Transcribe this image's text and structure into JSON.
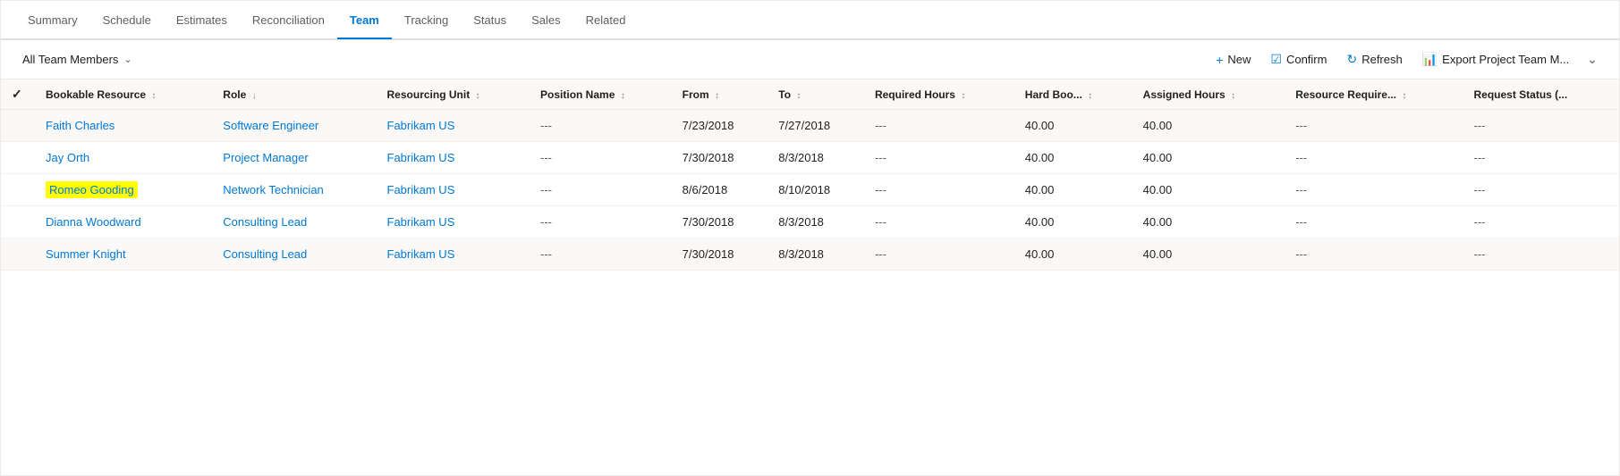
{
  "nav": {
    "tabs": [
      {
        "id": "summary",
        "label": "Summary",
        "active": false
      },
      {
        "id": "schedule",
        "label": "Schedule",
        "active": false
      },
      {
        "id": "estimates",
        "label": "Estimates",
        "active": false
      },
      {
        "id": "reconciliation",
        "label": "Reconciliation",
        "active": false
      },
      {
        "id": "team",
        "label": "Team",
        "active": true
      },
      {
        "id": "tracking",
        "label": "Tracking",
        "active": false
      },
      {
        "id": "status",
        "label": "Status",
        "active": false
      },
      {
        "id": "sales",
        "label": "Sales",
        "active": false
      },
      {
        "id": "related",
        "label": "Related",
        "active": false
      }
    ]
  },
  "toolbar": {
    "filter_label": "All Team Members",
    "new_label": "New",
    "confirm_label": "Confirm",
    "refresh_label": "Refresh",
    "export_label": "Export Project Team M...",
    "new_icon": "+",
    "confirm_icon": "☑",
    "refresh_icon": "↻",
    "export_icon": "📊"
  },
  "table": {
    "columns": [
      {
        "id": "bookable_resource",
        "label": "Bookable Resource",
        "sortable": true
      },
      {
        "id": "role",
        "label": "Role",
        "sortable": true
      },
      {
        "id": "resourcing_unit",
        "label": "Resourcing Unit",
        "sortable": true
      },
      {
        "id": "position_name",
        "label": "Position Name",
        "sortable": true
      },
      {
        "id": "from",
        "label": "From",
        "sortable": true
      },
      {
        "id": "to",
        "label": "To",
        "sortable": true
      },
      {
        "id": "required_hours",
        "label": "Required Hours",
        "sortable": true
      },
      {
        "id": "hard_boo",
        "label": "Hard Boo...",
        "sortable": true
      },
      {
        "id": "assigned_hours",
        "label": "Assigned Hours",
        "sortable": true
      },
      {
        "id": "resource_require",
        "label": "Resource Require...",
        "sortable": true
      },
      {
        "id": "request_status",
        "label": "Request Status (...",
        "sortable": true
      }
    ],
    "rows": [
      {
        "id": 1,
        "bookable_resource": "Faith Charles",
        "role": "Software Engineer",
        "resourcing_unit": "Fabrikam US",
        "position_name": "---",
        "from": "7/23/2018",
        "to": "7/27/2018",
        "required_hours": "---",
        "hard_boo": "40.00",
        "assigned_hours": "40.00",
        "resource_require": "---",
        "request_status": "---",
        "highlighted": false
      },
      {
        "id": 2,
        "bookable_resource": "Jay Orth",
        "role": "Project Manager",
        "resourcing_unit": "Fabrikam US",
        "position_name": "---",
        "from": "7/30/2018",
        "to": "8/3/2018",
        "required_hours": "---",
        "hard_boo": "40.00",
        "assigned_hours": "40.00",
        "resource_require": "---",
        "request_status": "---",
        "highlighted": false
      },
      {
        "id": 3,
        "bookable_resource": "Romeo Gooding",
        "role": "Network Technician",
        "resourcing_unit": "Fabrikam US",
        "position_name": "---",
        "from": "8/6/2018",
        "to": "8/10/2018",
        "required_hours": "---",
        "hard_boo": "40.00",
        "assigned_hours": "40.00",
        "resource_require": "---",
        "request_status": "---",
        "highlighted": true
      },
      {
        "id": 4,
        "bookable_resource": "Dianna Woodward",
        "role": "Consulting Lead",
        "resourcing_unit": "Fabrikam US",
        "position_name": "---",
        "from": "7/30/2018",
        "to": "8/3/2018",
        "required_hours": "---",
        "hard_boo": "40.00",
        "assigned_hours": "40.00",
        "resource_require": "---",
        "request_status": "---",
        "highlighted": false
      },
      {
        "id": 5,
        "bookable_resource": "Summer Knight",
        "role": "Consulting Lead",
        "resourcing_unit": "Fabrikam US",
        "position_name": "---",
        "from": "7/30/2018",
        "to": "8/3/2018",
        "required_hours": "---",
        "hard_boo": "40.00",
        "assigned_hours": "40.00",
        "resource_require": "---",
        "request_status": "---",
        "highlighted": false
      }
    ]
  }
}
